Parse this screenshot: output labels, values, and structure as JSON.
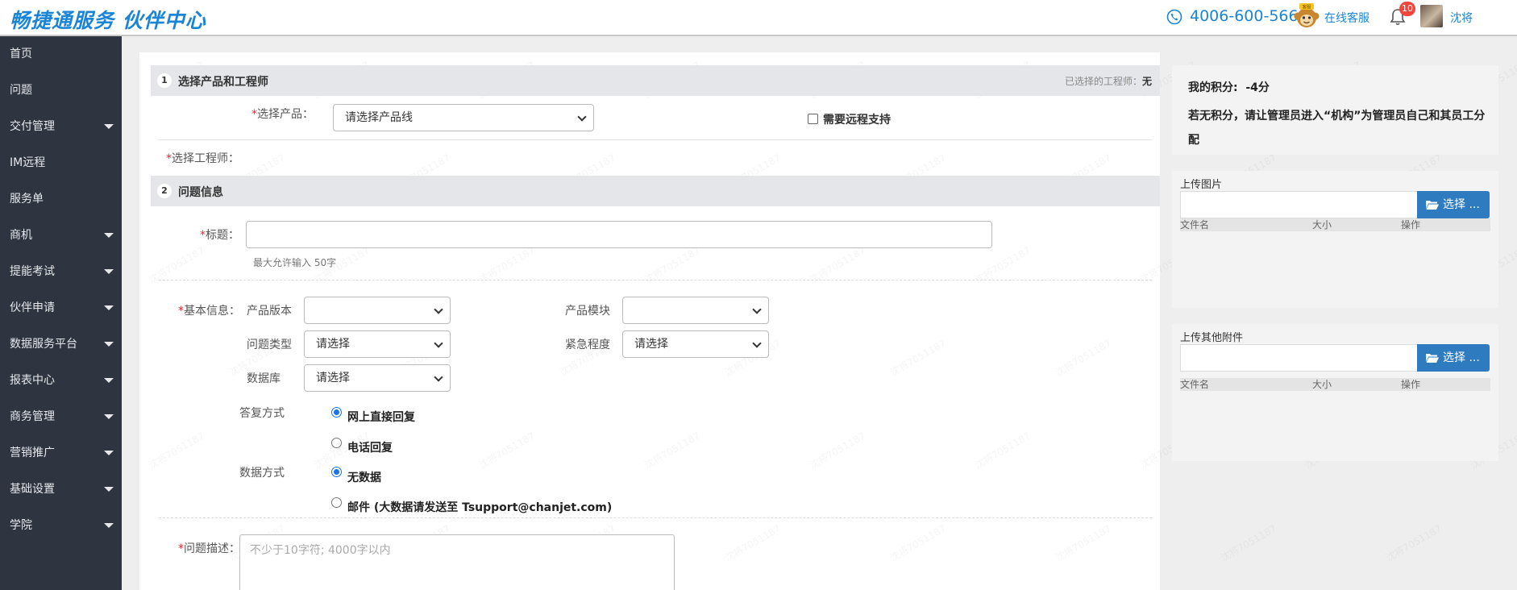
{
  "header": {
    "logo": "畅捷通服务  伙伴中心",
    "phone": "4006-600-566",
    "online_service": "在线客服",
    "notification_count": "10",
    "username": "沈将",
    "monkey_label": "客服"
  },
  "sidebar": {
    "items": [
      {
        "label": "首页",
        "has_submenu": false
      },
      {
        "label": "问题",
        "has_submenu": false
      },
      {
        "label": "交付管理",
        "has_submenu": true
      },
      {
        "label": "IM远程",
        "has_submenu": false
      },
      {
        "label": "服务单",
        "has_submenu": false
      },
      {
        "label": "商机",
        "has_submenu": true
      },
      {
        "label": "提能考试",
        "has_submenu": true
      },
      {
        "label": "伙伴申请",
        "has_submenu": true
      },
      {
        "label": "数据服务平台",
        "has_submenu": true
      },
      {
        "label": "报表中心",
        "has_submenu": true
      },
      {
        "label": "商务管理",
        "has_submenu": true
      },
      {
        "label": "营销推广",
        "has_submenu": true
      },
      {
        "label": "基础设置",
        "has_submenu": true
      },
      {
        "label": "学院",
        "has_submenu": true
      }
    ]
  },
  "section1": {
    "num": "1",
    "title": "选择产品和工程师",
    "selected_engineer_label": "已选择的工程师：",
    "selected_engineer_value": "无",
    "product_label": "选择产品：",
    "product_select": "请选择产品线",
    "remote_support": "需要远程支持",
    "engineer_label": "选择工程师："
  },
  "section2": {
    "num": "2",
    "title": "问题信息",
    "title_label": "标题：",
    "title_hint": "最大允许输入 50字",
    "basic_info_label": "基本信息：",
    "product_version_label": "产品版本",
    "product_version_value": "",
    "product_module_label": "产品模块",
    "product_module_value": "",
    "issue_type_label": "问题类型",
    "issue_type_value": "请选择",
    "urgency_label": "紧急程度",
    "urgency_value": "请选择",
    "database_label": "数据库",
    "database_value": "请选择",
    "reply_method_label": "答复方式",
    "reply_options": [
      "网上直接回复",
      "电话回复"
    ],
    "reply_selected": 0,
    "data_method_label": "数据方式",
    "data_options": [
      "无数据",
      "邮件 (大数据请发送至 Tsupport@chanjet.com)"
    ],
    "data_selected": 0,
    "description_label": "问题描述：",
    "description_placeholder": "不少于10字符; 4000字以内"
  },
  "right": {
    "score_label": "我的积分:",
    "score_value": "-4分",
    "score_note": "若无积分，请让管理员进入“机构”为管理员自己和其员工分配",
    "upload_image_title": "上传图片",
    "upload_other_title": "上传其他附件",
    "choose_label": "选择 ...",
    "col_filename": "文件名",
    "col_size": "大小",
    "col_action": "操作"
  },
  "watermark_text": "沈将7051187",
  "colors": {
    "brand": "#1a84d6",
    "sidebar_bg": "#2e3541",
    "button_blue": "#2e7bbf",
    "required": "#e23"
  }
}
